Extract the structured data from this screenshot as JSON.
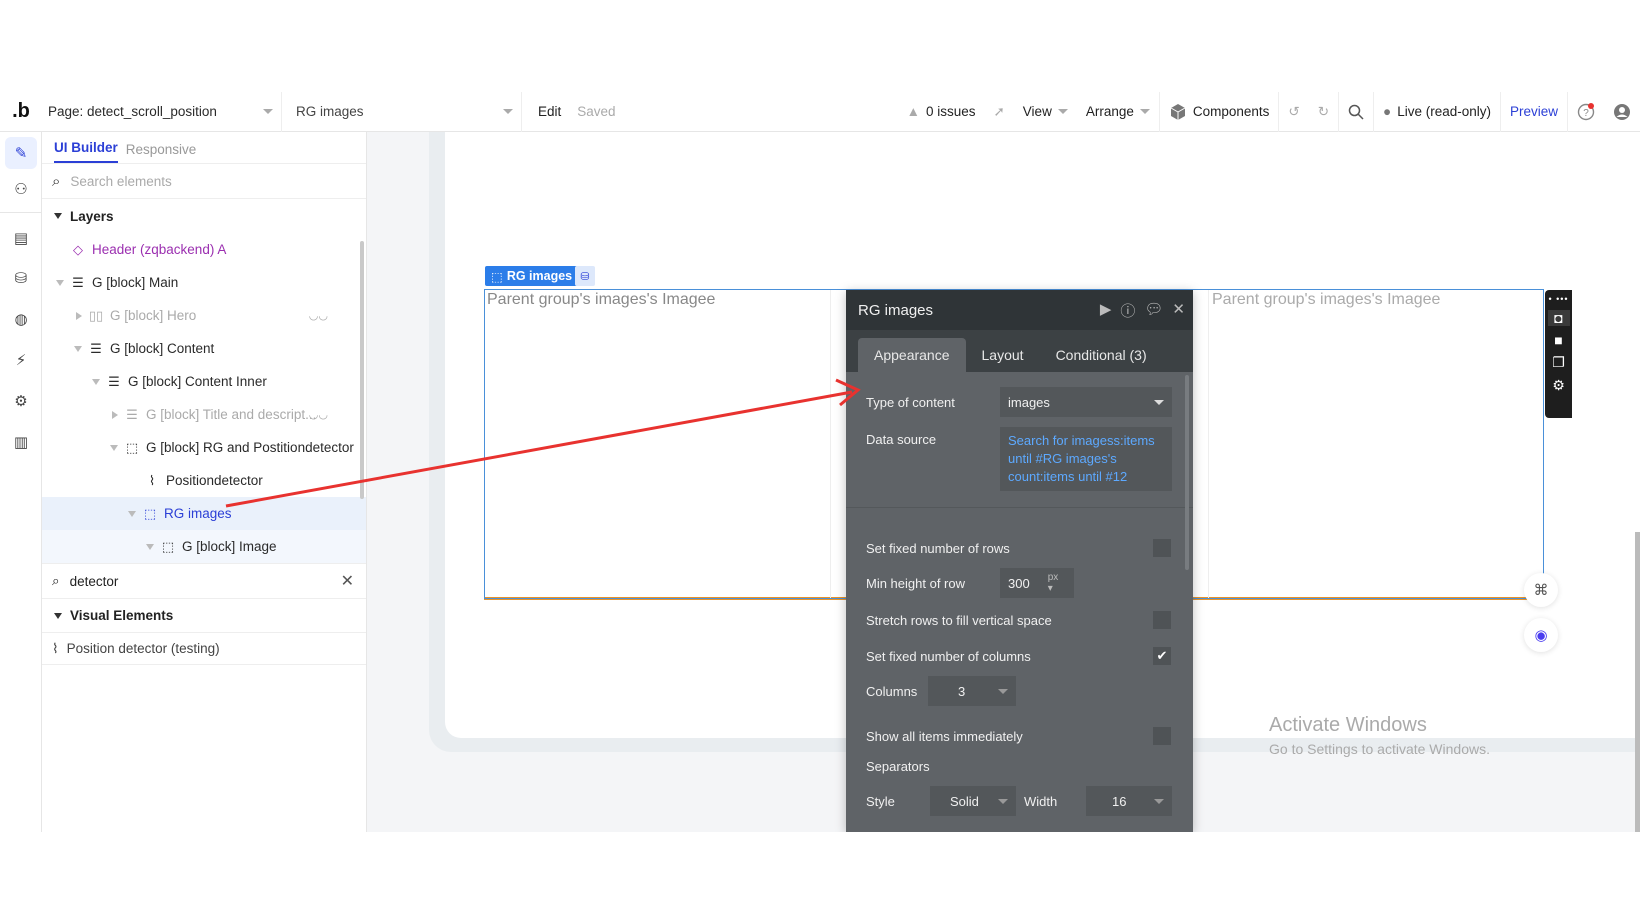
{
  "topbar": {
    "logo": ".b",
    "page_select": "Page: detect_scroll_position",
    "element_select": "RG images",
    "edit": "Edit",
    "saved": "Saved",
    "issues": "0 issues",
    "view": "View",
    "arrange": "Arrange",
    "components": "Components",
    "live": "Live (read-only)",
    "preview": "Preview"
  },
  "rail": {
    "items": [
      "design-pencil",
      "workflow",
      "data-tables",
      "database",
      "styles-palette",
      "plugins",
      "settings",
      "logs-chart"
    ]
  },
  "left_panel": {
    "tabs": [
      {
        "label": "UI Builder",
        "active": true
      },
      {
        "label": "Responsive",
        "active": false
      }
    ],
    "search_placeholder": "Search elements",
    "layers_title": "Layers",
    "layers": [
      {
        "label": "Header (zqbackend) A",
        "icon": "diamond-icon"
      },
      {
        "label": "G [block] Main",
        "icon": "group-rows-icon"
      },
      {
        "label": "G [block] Hero",
        "icon": "group-columns-icon"
      },
      {
        "label": "G [block] Content",
        "icon": "group-rows-icon"
      },
      {
        "label": "G [block] Content Inner",
        "icon": "group-rows-icon"
      },
      {
        "label": "G [block] Title and descript...",
        "icon": "group-rows-icon"
      },
      {
        "label": "G [block] RG and Postitiondetector",
        "icon": "dashed-group-icon"
      },
      {
        "label": "Positiondetector",
        "icon": "rss-icon"
      },
      {
        "label": "RG images",
        "icon": "repeating-group-icon"
      },
      {
        "label": "G [block] Image",
        "icon": "dashed-group-icon"
      }
    ],
    "element_search_value": "detector",
    "visual_elements_title": "Visual Elements",
    "visual_elements": [
      {
        "label": "Position detector (testing)",
        "icon": "rss-icon"
      }
    ]
  },
  "canvas": {
    "rg_tag": "RG images",
    "cells": [
      "Parent group's images's Imagee",
      "Parent group's images's Imagee"
    ],
    "activate_title": "Activate Windows",
    "activate_sub": "Go to Settings to activate Windows."
  },
  "property_editor": {
    "title": "RG images",
    "tabs": [
      {
        "label": "Appearance",
        "active": true
      },
      {
        "label": "Layout",
        "active": false
      },
      {
        "label": "Conditional (3)",
        "active": false
      }
    ],
    "type_of_content_label": "Type of content",
    "type_of_content_value": "images",
    "data_source_label": "Data source",
    "data_source_value": "Search for imagess:items until #RG images's count:items until #12",
    "fixed_rows_label": "Set fixed number of rows",
    "fixed_rows_checked": false,
    "min_height_label": "Min height of row",
    "min_height_value": "300",
    "min_height_unit": "px",
    "stretch_label": "Stretch rows to fill vertical space",
    "stretch_checked": false,
    "fixed_cols_label": "Set fixed number of columns",
    "fixed_cols_checked": true,
    "columns_label": "Columns",
    "columns_value": "3",
    "show_all_label": "Show all items immediately",
    "show_all_checked": false,
    "separators_label": "Separators",
    "style_label": "Style",
    "style_value": "Solid",
    "width_label": "Width",
    "width_value": "16"
  },
  "colors": {
    "accent_blue": "#2b3fd6",
    "selection_blue": "#2b7de9",
    "annotation_red": "#e8322f",
    "editor_bg": "#5f6367",
    "data_source_link": "#5da9ff"
  }
}
